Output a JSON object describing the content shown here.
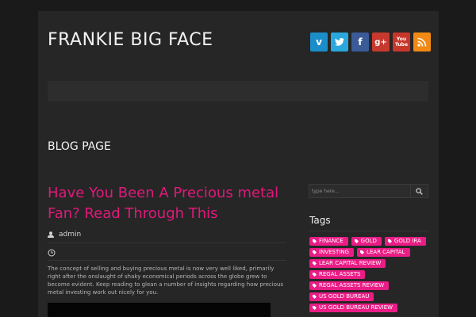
{
  "site": {
    "title": "FRANKIE BIG FACE"
  },
  "social": [
    {
      "name": "vimeo",
      "glyph": "v"
    },
    {
      "name": "twitter",
      "glyph": "t"
    },
    {
      "name": "facebook",
      "glyph": "f"
    },
    {
      "name": "google-plus",
      "glyph": "g+"
    },
    {
      "name": "youtube",
      "glyph": "You Tube"
    },
    {
      "name": "rss",
      "glyph": "rss"
    }
  ],
  "page_title": "BLOG PAGE",
  "post": {
    "title": "Have You Been A Precious metal Fan? Read Through This",
    "author": "admin",
    "excerpt": "The concept of selling and buying precious metal is now very well liked, primarily right after the onslaught of shaky economical periods across the globe grew to become evident. Keep reading to glean a number of insights regarding how precious metal investing work out nicely for you."
  },
  "search": {
    "placeholder": "type here..."
  },
  "tags": {
    "heading": "Tags",
    "items": [
      "FINANCE",
      "GOLD",
      "GOLD IRA",
      "INVESTING",
      "LEAR CAPITAL",
      "LEAR CAPITAL REVIEW",
      "REGAL ASSETS",
      "REGAL ASSETS REVIEW",
      "US GOLD BUREAU",
      "US GOLD BUREAU REVIEW"
    ]
  },
  "colors": {
    "accent": "#ea1d86",
    "post_title": "#e0197c",
    "background": "#1a1a1a",
    "panel": "#262626"
  }
}
